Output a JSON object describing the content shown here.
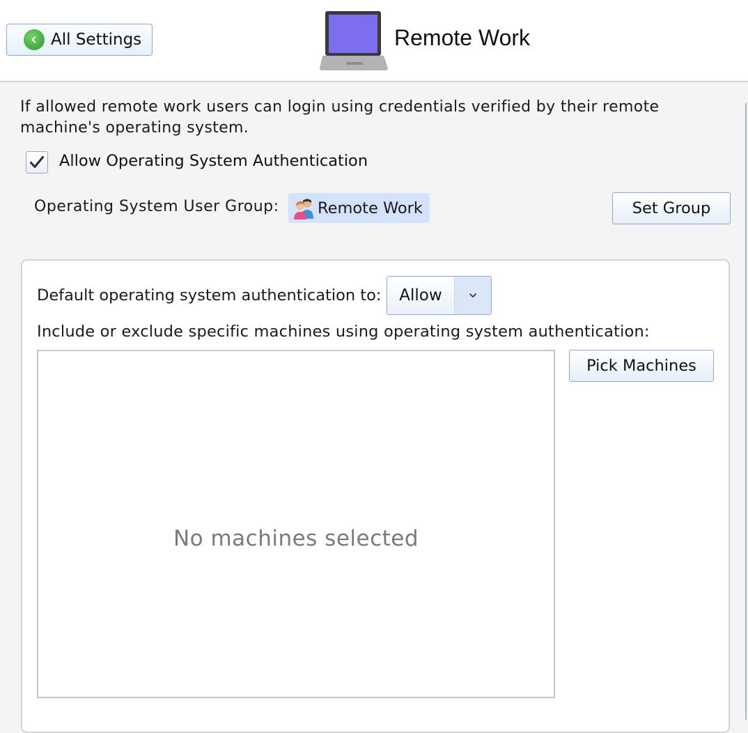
{
  "header": {
    "back_label": "All Settings",
    "title": "Remote Work",
    "icon": "laptop-icon"
  },
  "description": "If allowed remote work users can login using credentials verified by their remote machine's operating system.",
  "os_auth": {
    "checkbox_label": "Allow Operating System Authentication",
    "checked": true
  },
  "user_group": {
    "label": "Operating System User Group:",
    "value": "Remote Work",
    "icon": "user-group-icon",
    "set_button": "Set Group"
  },
  "machines": {
    "default_label": "Default operating system authentication to:",
    "default_value": "Allow",
    "include_label": "Include or exclude specific machines using operating system authentication:",
    "pick_button": "Pick Machines",
    "empty_text": "No machines selected"
  },
  "colors": {
    "accent": "#8fa8c8",
    "chip_bg": "#d4e3fb",
    "back_green": "#2e9a2b",
    "laptop_screen": "#7d6ef0"
  }
}
